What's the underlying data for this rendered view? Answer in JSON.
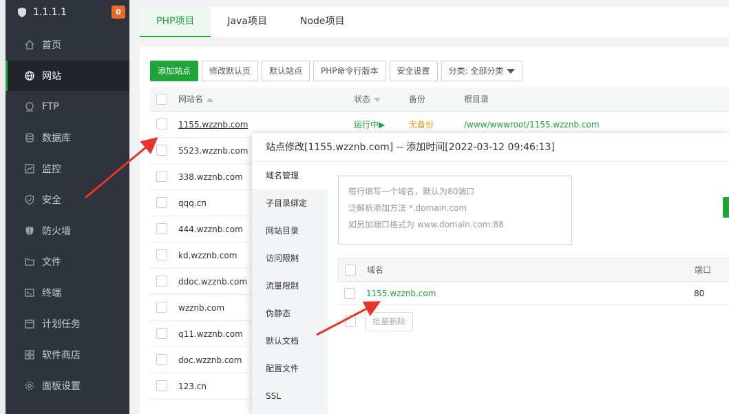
{
  "sidebar": {
    "server_ip": "1.1.1.1",
    "badge": "0",
    "items": [
      {
        "label": "首页",
        "icon": "home-icon"
      },
      {
        "label": "网站",
        "icon": "globe-icon"
      },
      {
        "label": "FTP",
        "icon": "ftp-icon"
      },
      {
        "label": "数据库",
        "icon": "database-icon"
      },
      {
        "label": "监控",
        "icon": "monitor-icon"
      },
      {
        "label": "安全",
        "icon": "shield-icon"
      },
      {
        "label": "防火墙",
        "icon": "firewall-icon"
      },
      {
        "label": "文件",
        "icon": "folder-icon"
      },
      {
        "label": "终端",
        "icon": "terminal-icon"
      },
      {
        "label": "计划任务",
        "icon": "calendar-icon"
      },
      {
        "label": "软件商店",
        "icon": "apps-icon"
      },
      {
        "label": "面板设置",
        "icon": "gear-icon"
      }
    ]
  },
  "tabs": [
    "PHP项目",
    "Java项目",
    "Node项目"
  ],
  "toolbar": {
    "add_site": "添加站点",
    "edit_default_page": "修改默认页",
    "default_site": "默认站点",
    "php_cli": "PHP命令行版本",
    "security": "安全设置",
    "category": "分类: 全部分类"
  },
  "table": {
    "headers": {
      "name": "网站名",
      "status": "状态",
      "backup": "备份",
      "root": "根目录"
    },
    "rows": [
      {
        "name": "1155.wzznb.com",
        "status": "运行中▶",
        "backup": "无备份",
        "path": "/www/wwwroot/1155.wzznb.com"
      },
      {
        "name": "5523.wzznb.com"
      },
      {
        "name": "338.wzznb.com"
      },
      {
        "name": "qqq.cn"
      },
      {
        "name": "444.wzznb.com"
      },
      {
        "name": "kd.wzznb.com"
      },
      {
        "name": "ddoc.wzznb.com"
      },
      {
        "name": "wzznb.com"
      },
      {
        "name": "q11.wzznb.com"
      },
      {
        "name": "doc.wzznb.com"
      },
      {
        "name": "123.cn"
      }
    ]
  },
  "modal": {
    "title": "站点修改[1155.wzznb.com] -- 添加时间[2022-03-12 09:46:13]",
    "nav": [
      "域名管理",
      "子目录绑定",
      "网站目录",
      "访问限制",
      "流量限制",
      "伪静态",
      "默认文档",
      "配置文件",
      "SSL"
    ],
    "placeholder_lines": [
      "每行填写一个域名，默认为80端口",
      "泛解析添加方法 *.domain.com",
      "如另加端口格式为 www.domain.com:88"
    ],
    "domain_table": {
      "header_domain": "域名",
      "header_port": "端口",
      "rows": [
        {
          "domain": "1155.wzznb.com",
          "port": "80"
        }
      ]
    },
    "batch_delete": "批量删除"
  },
  "colors": {
    "accent": "#20a53a",
    "sidebar_bg": "#2f333b",
    "arrow": "#e8332b",
    "badge": "#e96a2b"
  }
}
